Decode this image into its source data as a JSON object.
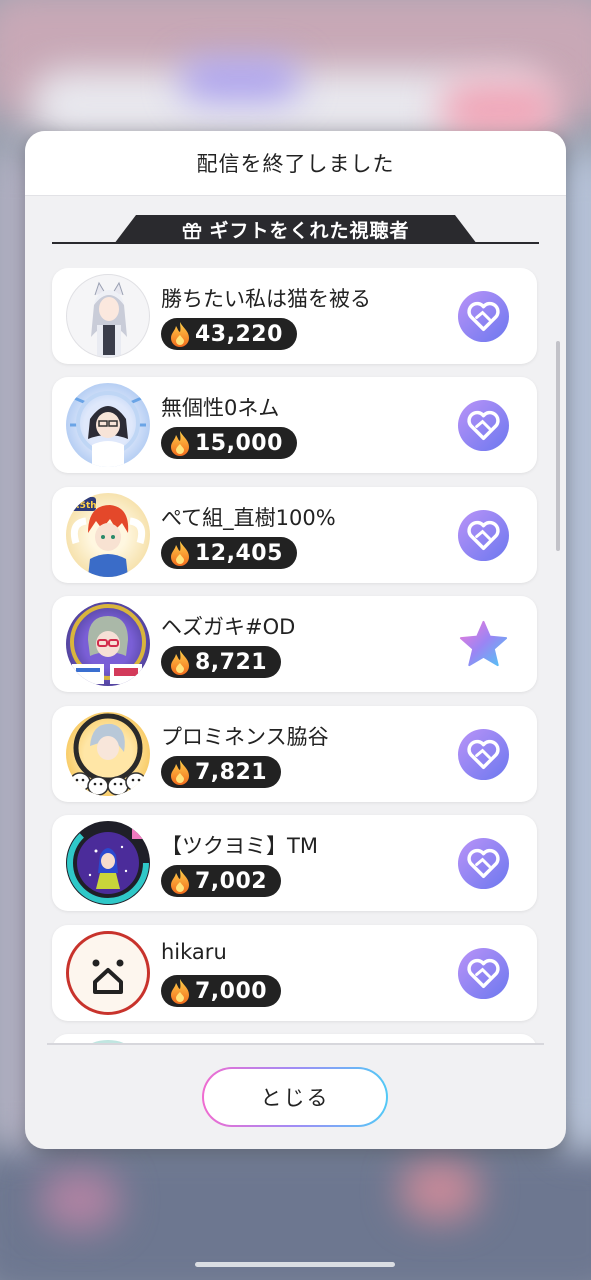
{
  "modal": {
    "title": "配信を終了しました",
    "section_title": "ギフトをくれた視聴者",
    "close_label": "とじる"
  },
  "viewers": [
    {
      "name": "勝ちたい私は猫を被る",
      "points": "43,220",
      "badge": "handshake-heart-icon"
    },
    {
      "name": "無個性0ネム",
      "points": "15,000",
      "badge": "handshake-heart-icon"
    },
    {
      "name": "ぺて組_直樹100%",
      "points": "12,405",
      "badge": "handshake-heart-icon"
    },
    {
      "name": "ヘズガキ#OD",
      "points": "8,721",
      "badge": "star-icon"
    },
    {
      "name": "プロミネンス脇谷",
      "points": "7,821",
      "badge": "handshake-heart-icon"
    },
    {
      "name": "【ツクヨミ】TM",
      "points": "7,002",
      "badge": "handshake-heart-icon"
    },
    {
      "name": "hikaru",
      "points": "7,000",
      "badge": "handshake-heart-icon"
    }
  ],
  "colors": {
    "badge_gradient": [
      "#b28cf6",
      "#6f7bf0"
    ],
    "star_gradient": [
      "#f27ad8",
      "#8e86f5",
      "#4fc8f5"
    ],
    "flame": "#f5a623"
  }
}
